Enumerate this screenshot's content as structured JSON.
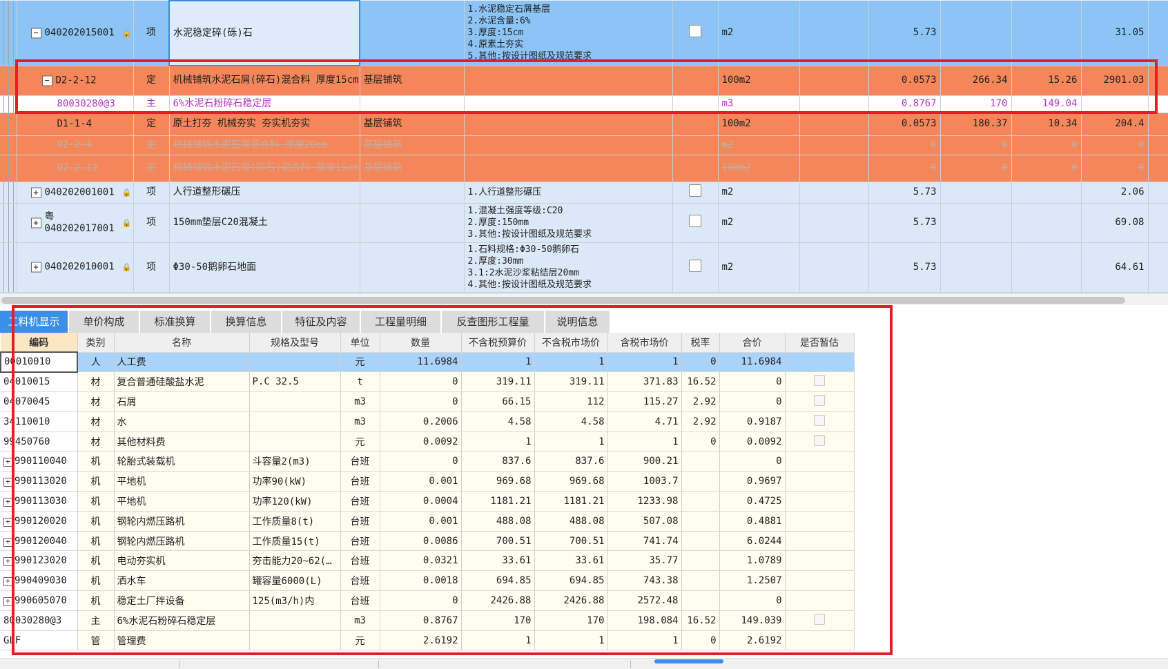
{
  "upper_rows": [
    {
      "style": "blue",
      "tree": "−",
      "code": "040202015001",
      "lock": true,
      "type": "项",
      "name": "水泥稳定碎(砾)石",
      "spec": "",
      "features": [
        "1.水泥稳定石屑基层",
        "2.水泥含量:6%",
        "3.厚度:15cm",
        "4.原素土夯实",
        "5.其他:按设计图纸及规范要求"
      ],
      "checkbox": true,
      "unit": "m2",
      "qty": "5.73",
      "price": "",
      "c2": "",
      "total": "31.05"
    },
    {
      "style": "orange",
      "tree": "−",
      "code": "D2-2-12",
      "lock": false,
      "type": "定",
      "name": "机械铺筑水泥石屑(碎石)混合料 厚度15cm",
      "spec": "基层铺筑",
      "features": [],
      "checkbox": false,
      "unit": "100m2",
      "qty": "0.0573",
      "price": "266.34",
      "c2": "15.26",
      "total": "2901.03"
    },
    {
      "style": "white",
      "tree": "",
      "code": "80030280@3",
      "lock": false,
      "type": "主",
      "name": "6%水泥石粉碎石稳定层",
      "spec": "",
      "features": [],
      "checkbox": false,
      "unit": "m3",
      "qty": "0.8767",
      "price": "170",
      "c2": "149.04",
      "total": ""
    },
    {
      "style": "orange",
      "tree": "",
      "code": "D1-1-4",
      "lock": false,
      "type": "定",
      "name": "原土打夯 机械夯实 夯实机夯实",
      "spec": "基层铺筑",
      "features": [],
      "checkbox": false,
      "unit": "100m2",
      "qty": "0.0573",
      "price": "180.37",
      "c2": "10.34",
      "total": "204.4"
    },
    {
      "style": "orange-dim",
      "tree": "",
      "code": "D2-2-4",
      "lock": false,
      "type": "定",
      "name": "机械铺筑水泥石屑混合料 厚度20cm",
      "spec": "基层铺筑",
      "features": [],
      "checkbox": false,
      "unit": "m2",
      "qty": "0",
      "price": "0",
      "c2": "0",
      "total": "0"
    },
    {
      "style": "orange-dim",
      "tree": "",
      "code": "D2-2-12",
      "lock": false,
      "type": "定",
      "name": "机械铺筑水泥石屑(碎石)混合料 厚度15cm",
      "spec": "基层铺筑",
      "features": [],
      "checkbox": false,
      "unit": "100m2",
      "qty": "0",
      "price": "0",
      "c2": "0",
      "total": "0"
    },
    {
      "style": "light",
      "tree": "+",
      "code": "040202001001",
      "lock": true,
      "type": "项",
      "name": "人行道整形碾压",
      "spec": "",
      "features": [
        "1.人行道整形碾压"
      ],
      "checkbox": true,
      "unit": "m2",
      "qty": "5.73",
      "price": "",
      "c2": "",
      "total": "2.06"
    },
    {
      "style": "light",
      "tree": "+",
      "code": "粤 040202017001",
      "lock": true,
      "type": "项",
      "name": "150mm垫层C20混凝土",
      "spec": "",
      "features": [
        "1.混凝土强度等级:C20",
        "2.厚度:150mm",
        "3.其他:按设计图纸及规范要求"
      ],
      "checkbox": true,
      "unit": "m2",
      "qty": "5.73",
      "price": "",
      "c2": "",
      "total": "69.08"
    },
    {
      "style": "light",
      "tree": "+",
      "code": "040202010001",
      "lock": true,
      "type": "项",
      "name": "Φ30-50鹅卵石地面",
      "spec": "",
      "features": [
        "1.石料规格:Φ30-50鹅卵石",
        "2.厚度:30mm",
        "3.1:2水泥沙浆粘结层20mm",
        "4.其他:按设计图纸及规范要求"
      ],
      "checkbox": true,
      "unit": "m2",
      "qty": "5.73",
      "price": "",
      "c2": "",
      "total": "64.61"
    }
  ],
  "tabs": [
    "工料机显示",
    "单价构成",
    "标准换算",
    "换算信息",
    "特征及内容",
    "工程量明细",
    "反查图形工程量",
    "说明信息"
  ],
  "sub_headers": [
    "编码",
    "类别",
    "名称",
    "规格及型号",
    "单位",
    "数量",
    "不含税预算价",
    "不含税市场价",
    "含税市场价",
    "税率",
    "合价",
    "是否暂估"
  ],
  "sub_rows": [
    {
      "expand": false,
      "code": "00010010",
      "cat": "人",
      "name": "人工费",
      "spec": "",
      "unit": "元",
      "qty": "11.6984",
      "budget": "1",
      "market": "1",
      "taxmarket": "1",
      "tax": "0",
      "total": "11.6984",
      "chk": false,
      "sel": true
    },
    {
      "expand": false,
      "code": "04010015",
      "cat": "材",
      "name": "复合普通硅酸盐水泥",
      "spec": "P.C 32.5",
      "unit": "t",
      "qty": "0",
      "budget": "319.11",
      "market": "319.11",
      "taxmarket": "371.83",
      "tax": "16.52",
      "total": "0",
      "chk": true,
      "sel": false
    },
    {
      "expand": false,
      "code": "04070045",
      "cat": "材",
      "name": "石屑",
      "spec": "",
      "unit": "m3",
      "qty": "0",
      "budget": "66.15",
      "market": "112",
      "taxmarket": "115.27",
      "tax": "2.92",
      "total": "0",
      "chk": true,
      "sel": false
    },
    {
      "expand": false,
      "code": "34110010",
      "cat": "材",
      "name": "水",
      "spec": "",
      "unit": "m3",
      "qty": "0.2006",
      "budget": "4.58",
      "market": "4.58",
      "taxmarket": "4.71",
      "tax": "2.92",
      "total": "0.9187",
      "chk": true,
      "sel": false
    },
    {
      "expand": false,
      "code": "99450760",
      "cat": "材",
      "name": "其他材料费",
      "spec": "",
      "unit": "元",
      "qty": "0.0092",
      "budget": "1",
      "market": "1",
      "taxmarket": "1",
      "tax": "0",
      "total": "0.0092",
      "chk": true,
      "sel": false
    },
    {
      "expand": true,
      "code": "990110040",
      "cat": "机",
      "name": "轮胎式装载机",
      "spec": "斗容量2(m3)",
      "unit": "台班",
      "qty": "0",
      "budget": "837.6",
      "market": "837.6",
      "taxmarket": "900.21",
      "tax": "",
      "total": "0",
      "chk": false,
      "sel": false
    },
    {
      "expand": true,
      "code": "990113020",
      "cat": "机",
      "name": "平地机",
      "spec": "功率90(kW)",
      "unit": "台班",
      "qty": "0.001",
      "budget": "969.68",
      "market": "969.68",
      "taxmarket": "1003.7",
      "tax": "",
      "total": "0.9697",
      "chk": false,
      "sel": false
    },
    {
      "expand": true,
      "code": "990113030",
      "cat": "机",
      "name": "平地机",
      "spec": "功率120(kW)",
      "unit": "台班",
      "qty": "0.0004",
      "budget": "1181.21",
      "market": "1181.21",
      "taxmarket": "1233.98",
      "tax": "",
      "total": "0.4725",
      "chk": false,
      "sel": false
    },
    {
      "expand": true,
      "code": "990120020",
      "cat": "机",
      "name": "钢轮内燃压路机",
      "spec": "工作质量8(t)",
      "unit": "台班",
      "qty": "0.001",
      "budget": "488.08",
      "market": "488.08",
      "taxmarket": "507.08",
      "tax": "",
      "total": "0.4881",
      "chk": false,
      "sel": false
    },
    {
      "expand": true,
      "code": "990120040",
      "cat": "机",
      "name": "钢轮内燃压路机",
      "spec": "工作质量15(t)",
      "unit": "台班",
      "qty": "0.0086",
      "budget": "700.51",
      "market": "700.51",
      "taxmarket": "741.74",
      "tax": "",
      "total": "6.0244",
      "chk": false,
      "sel": false
    },
    {
      "expand": true,
      "code": "990123020",
      "cat": "机",
      "name": "电动夯实机",
      "spec": "夯击能力20~62(…",
      "unit": "台班",
      "qty": "0.0321",
      "budget": "33.61",
      "market": "33.61",
      "taxmarket": "35.77",
      "tax": "",
      "total": "1.0789",
      "chk": false,
      "sel": false
    },
    {
      "expand": true,
      "code": "990409030",
      "cat": "机",
      "name": "洒水车",
      "spec": "罐容量6000(L)",
      "unit": "台班",
      "qty": "0.0018",
      "budget": "694.85",
      "market": "694.85",
      "taxmarket": "743.38",
      "tax": "",
      "total": "1.2507",
      "chk": false,
      "sel": false
    },
    {
      "expand": true,
      "code": "990605070",
      "cat": "机",
      "name": "稳定土厂拌设备",
      "spec": "125(m3/h)内",
      "unit": "台班",
      "qty": "0",
      "budget": "2426.88",
      "market": "2426.88",
      "taxmarket": "2572.48",
      "tax": "",
      "total": "0",
      "chk": false,
      "sel": false
    },
    {
      "expand": false,
      "code": "80030280@3",
      "cat": "主",
      "name": "6%水泥石粉碎石稳定层",
      "spec": "",
      "unit": "m3",
      "qty": "0.8767",
      "budget": "170",
      "market": "170",
      "taxmarket": "198.084",
      "tax": "16.52",
      "total": "149.039",
      "chk": true,
      "sel": false
    },
    {
      "expand": false,
      "code": "GLF",
      "cat": "管",
      "name": "管理费",
      "spec": "",
      "unit": "元",
      "qty": "2.6192",
      "budget": "1",
      "market": "1",
      "taxmarket": "1",
      "tax": "0",
      "total": "2.6192",
      "chk": false,
      "sel": false
    }
  ],
  "colors": {
    "blue_row": "#8cc4f5",
    "orange_row": "#f4865a",
    "light_row": "#dbe8f7",
    "tab_active": "#3c8fe6",
    "highlight_red": "#e21f26",
    "sub_row_bg": "#fffdf0",
    "sub_sel": "#a9d3fb"
  }
}
